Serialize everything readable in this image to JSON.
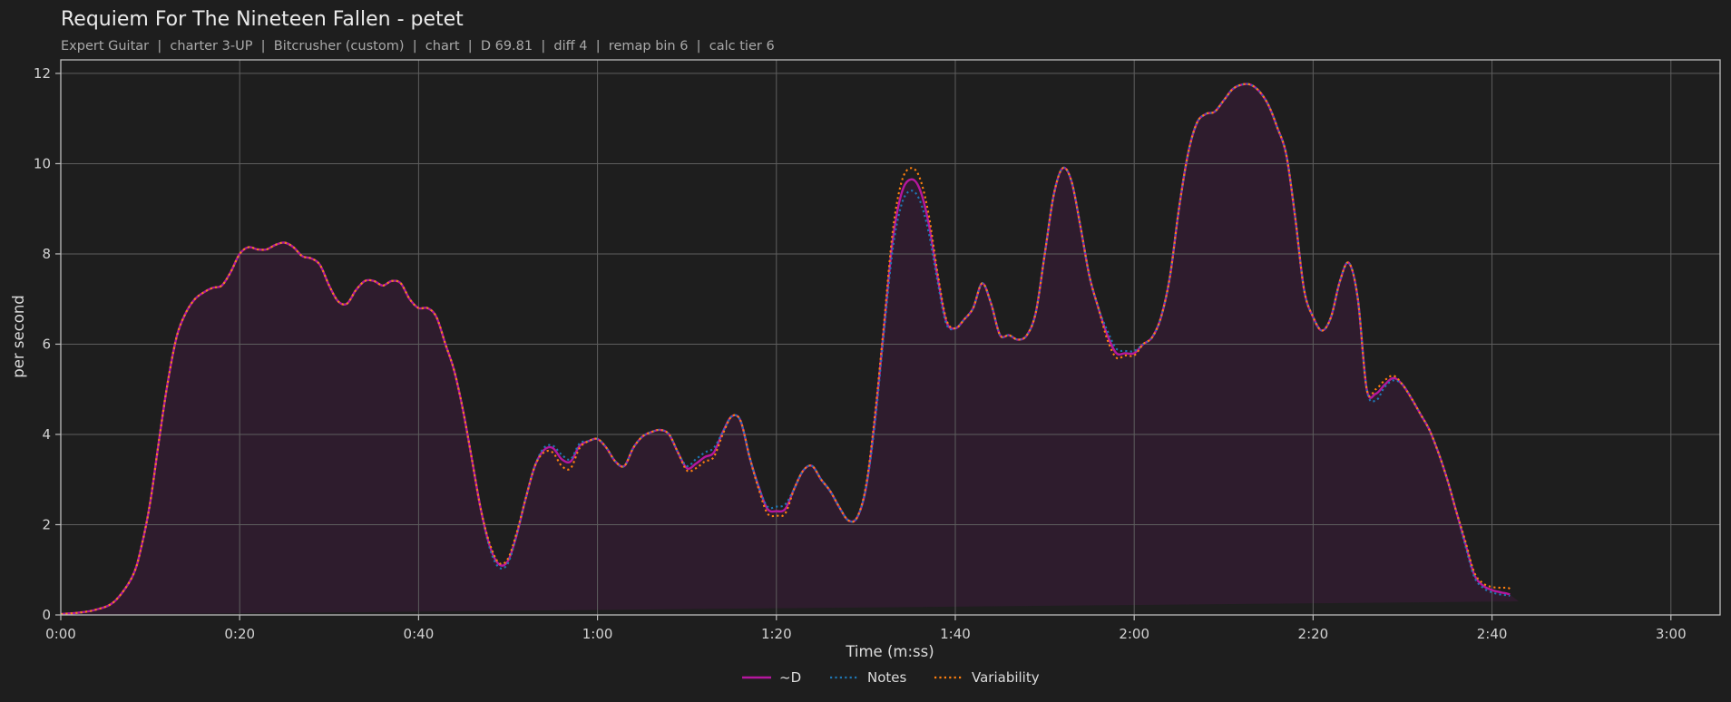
{
  "title": "Requiem For The Nineteen Fallen - petet",
  "subtitle": "Expert Guitar  |  charter 3-UP  |  Bitcrusher (custom)  |  chart  |  D 69.81  |  diff 4  |  remap bin 6  |  calc tier 6",
  "chart_data": {
    "type": "line",
    "title": "Requiem For The Nineteen Fallen - petet",
    "xlabel": "Time (m:ss)",
    "ylabel": "per second",
    "xlim": [
      0,
      185.5
    ],
    "ylim": [
      0,
      12.3
    ],
    "grid": true,
    "legend_placement": "bottom-center",
    "xticks": [
      {
        "value": 0,
        "label": "0:00"
      },
      {
        "value": 20,
        "label": "0:20"
      },
      {
        "value": 40,
        "label": "0:40"
      },
      {
        "value": 60,
        "label": "1:00"
      },
      {
        "value": 80,
        "label": "1:20"
      },
      {
        "value": 100,
        "label": "1:40"
      },
      {
        "value": 120,
        "label": "2:00"
      },
      {
        "value": 140,
        "label": "2:20"
      },
      {
        "value": 160,
        "label": "2:40"
      },
      {
        "value": 180,
        "label": "3:00"
      }
    ],
    "yticks": [
      0,
      2,
      4,
      6,
      8,
      10,
      12
    ],
    "x": [
      0,
      2,
      4,
      6,
      8,
      9,
      10,
      11,
      12,
      13,
      14,
      15,
      16,
      17,
      18,
      19,
      20,
      21,
      22,
      23,
      24,
      25,
      26,
      27,
      28,
      29,
      30,
      31,
      32,
      33,
      34,
      35,
      36,
      37,
      38,
      39,
      40,
      41,
      42,
      43,
      44,
      45,
      46,
      47,
      48,
      49,
      50,
      51,
      52,
      53,
      54,
      55,
      56,
      57,
      58,
      59,
      60,
      61,
      62,
      63,
      64,
      65,
      66,
      67,
      68,
      69,
      70,
      71,
      72,
      73,
      74,
      75,
      76,
      77,
      78,
      79,
      80,
      81,
      82,
      83,
      84,
      85,
      86,
      87,
      88,
      89,
      90,
      91,
      92,
      93,
      94,
      95,
      96,
      97,
      98,
      99,
      100,
      101,
      102,
      103,
      104,
      105,
      106,
      107,
      108,
      109,
      110,
      111,
      112,
      113,
      114,
      115,
      116,
      117,
      118,
      119,
      120,
      121,
      122,
      123,
      124,
      125,
      126,
      127,
      128,
      129,
      130,
      131,
      132,
      133,
      134,
      135,
      136,
      137,
      138,
      139,
      140,
      141,
      142,
      143,
      144,
      145,
      146,
      147,
      148,
      149,
      150,
      151,
      152,
      153,
      154,
      155,
      156,
      157,
      158,
      159,
      160,
      161,
      162,
      163,
      164,
      165,
      166,
      167,
      168,
      169,
      170,
      171,
      172,
      173,
      174,
      175,
      176,
      177,
      178,
      179,
      180,
      181,
      182,
      183,
      184,
      185,
      185.5
    ],
    "series": [
      {
        "name": "~D",
        "color": "#b5179e",
        "style": "solid",
        "values": [
          0.02,
          0.05,
          0.12,
          0.3,
          0.85,
          1.5,
          2.5,
          3.9,
          5.2,
          6.2,
          6.7,
          7.0,
          7.15,
          7.25,
          7.3,
          7.6,
          8.0,
          8.15,
          8.1,
          8.1,
          8.2,
          8.25,
          8.15,
          7.95,
          7.9,
          7.75,
          7.3,
          6.95,
          6.9,
          7.2,
          7.4,
          7.4,
          7.3,
          7.4,
          7.35,
          7.0,
          6.8,
          6.8,
          6.6,
          6.0,
          5.4,
          4.5,
          3.4,
          2.3,
          1.5,
          1.12,
          1.2,
          1.8,
          2.6,
          3.3,
          3.65,
          3.7,
          3.45,
          3.4,
          3.75,
          3.85,
          3.9,
          3.7,
          3.4,
          3.3,
          3.7,
          3.95,
          4.05,
          4.1,
          4.0,
          3.6,
          3.25,
          3.35,
          3.5,
          3.6,
          4.05,
          4.4,
          4.3,
          3.5,
          2.85,
          2.35,
          2.3,
          2.35,
          2.8,
          3.2,
          3.3,
          3.0,
          2.75,
          2.4,
          2.1,
          2.15,
          2.8,
          4.3,
          6.3,
          8.3,
          9.35,
          9.65,
          9.45,
          8.7,
          7.5,
          6.5,
          6.35,
          6.55,
          6.8,
          7.35,
          6.9,
          6.2,
          6.2,
          6.1,
          6.2,
          6.7,
          8.0,
          9.3,
          9.9,
          9.6,
          8.6,
          7.5,
          6.8,
          6.2,
          5.8,
          5.8,
          5.8,
          6.0,
          6.15,
          6.6,
          7.5,
          9.0,
          10.2,
          10.9,
          11.1,
          11.15,
          11.4,
          11.65,
          11.75,
          11.75,
          11.6,
          11.3,
          10.8,
          10.2,
          8.8,
          7.2,
          6.6,
          6.3,
          6.6,
          7.4,
          7.8,
          7.0,
          5.0,
          4.9,
          5.1,
          5.25,
          5.1,
          4.8,
          4.45,
          4.1,
          3.6,
          3.0,
          2.3,
          1.6,
          0.9,
          0.65,
          0.55,
          0.5,
          0.45,
          0.3
        ]
      },
      {
        "name": "Notes",
        "color": "#1f77b4",
        "style": "dotted",
        "values": [
          0.02,
          0.05,
          0.12,
          0.3,
          0.85,
          1.5,
          2.5,
          3.9,
          5.2,
          6.2,
          6.7,
          7.0,
          7.15,
          7.25,
          7.3,
          7.6,
          8.0,
          8.15,
          8.1,
          8.1,
          8.2,
          8.25,
          8.15,
          7.95,
          7.9,
          7.75,
          7.3,
          6.95,
          6.9,
          7.2,
          7.4,
          7.4,
          7.3,
          7.4,
          7.35,
          7.0,
          6.8,
          6.8,
          6.6,
          6.0,
          5.4,
          4.5,
          3.4,
          2.3,
          1.45,
          1.05,
          1.15,
          1.8,
          2.6,
          3.3,
          3.7,
          3.75,
          3.55,
          3.45,
          3.8,
          3.85,
          3.9,
          3.7,
          3.4,
          3.3,
          3.7,
          3.95,
          4.05,
          4.1,
          4.0,
          3.6,
          3.3,
          3.45,
          3.6,
          3.7,
          4.05,
          4.4,
          4.3,
          3.5,
          2.85,
          2.4,
          2.4,
          2.45,
          2.8,
          3.2,
          3.3,
          3.0,
          2.75,
          2.4,
          2.1,
          2.15,
          2.8,
          4.2,
          6.2,
          8.1,
          9.1,
          9.4,
          9.2,
          8.5,
          7.4,
          6.45,
          6.35,
          6.55,
          6.8,
          7.35,
          6.9,
          6.2,
          6.2,
          6.1,
          6.2,
          6.7,
          8.0,
          9.3,
          9.9,
          9.6,
          8.6,
          7.5,
          6.8,
          6.3,
          5.9,
          5.85,
          5.85,
          6.0,
          6.15,
          6.6,
          7.5,
          9.0,
          10.2,
          10.9,
          11.1,
          11.15,
          11.4,
          11.65,
          11.75,
          11.75,
          11.6,
          11.3,
          10.8,
          10.2,
          8.8,
          7.2,
          6.6,
          6.3,
          6.6,
          7.4,
          7.8,
          7.0,
          5.0,
          4.75,
          5.05,
          5.2,
          5.1,
          4.8,
          4.45,
          4.1,
          3.6,
          3.0,
          2.3,
          1.55,
          0.85,
          0.6,
          0.5,
          0.45,
          0.42,
          0.28
        ]
      },
      {
        "name": "Variability",
        "color": "#ff7f0e",
        "style": "dotted",
        "values": [
          0.02,
          0.05,
          0.12,
          0.3,
          0.85,
          1.5,
          2.5,
          3.9,
          5.2,
          6.2,
          6.7,
          7.0,
          7.15,
          7.25,
          7.3,
          7.6,
          8.0,
          8.15,
          8.1,
          8.1,
          8.2,
          8.25,
          8.15,
          7.95,
          7.9,
          7.75,
          7.3,
          6.95,
          6.9,
          7.2,
          7.4,
          7.4,
          7.3,
          7.4,
          7.35,
          7.0,
          6.8,
          6.8,
          6.6,
          6.0,
          5.4,
          4.5,
          3.4,
          2.3,
          1.55,
          1.15,
          1.25,
          1.85,
          2.6,
          3.3,
          3.6,
          3.6,
          3.3,
          3.25,
          3.7,
          3.85,
          3.9,
          3.7,
          3.4,
          3.3,
          3.7,
          3.95,
          4.05,
          4.1,
          4.0,
          3.6,
          3.2,
          3.25,
          3.4,
          3.5,
          4.0,
          4.4,
          4.3,
          3.5,
          2.8,
          2.25,
          2.2,
          2.25,
          2.8,
          3.2,
          3.3,
          3.0,
          2.75,
          2.4,
          2.1,
          2.15,
          2.85,
          4.4,
          6.4,
          8.5,
          9.6,
          9.9,
          9.7,
          8.9,
          7.6,
          6.55,
          6.35,
          6.55,
          6.8,
          7.35,
          6.9,
          6.2,
          6.2,
          6.1,
          6.2,
          6.7,
          8.0,
          9.3,
          9.9,
          9.6,
          8.6,
          7.5,
          6.8,
          6.1,
          5.7,
          5.75,
          5.75,
          6.0,
          6.15,
          6.6,
          7.5,
          9.0,
          10.2,
          10.9,
          11.1,
          11.15,
          11.4,
          11.65,
          11.75,
          11.75,
          11.6,
          11.3,
          10.8,
          10.2,
          8.8,
          7.2,
          6.6,
          6.3,
          6.6,
          7.4,
          7.8,
          7.0,
          5.0,
          5.0,
          5.2,
          5.3,
          5.1,
          4.8,
          4.45,
          4.1,
          3.6,
          3.0,
          2.3,
          1.65,
          0.95,
          0.7,
          0.62,
          0.6,
          0.58,
          0.32
        ]
      }
    ],
    "area_fill": {
      "series": "~D",
      "color": "#2e1c2d"
    }
  }
}
